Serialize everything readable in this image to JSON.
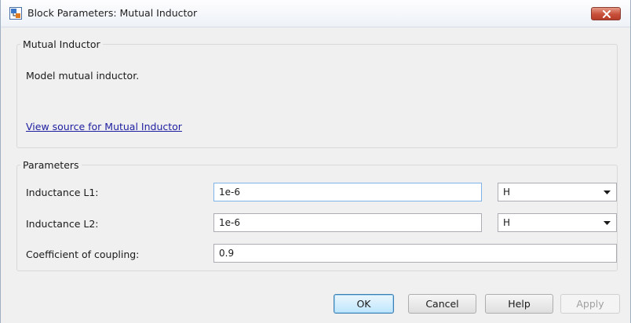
{
  "window": {
    "title": "Block Parameters: Mutual Inductor"
  },
  "description_group": {
    "title": "Mutual Inductor",
    "description": "Model mutual inductor.",
    "source_link": "View source for Mutual Inductor"
  },
  "parameters_group": {
    "title": "Parameters",
    "rows": [
      {
        "label": "Inductance L1:",
        "value": "1e-6",
        "unit": "H"
      },
      {
        "label": "Inductance L2:",
        "value": "1e-6",
        "unit": "H"
      },
      {
        "label": "Coefficient of coupling:",
        "value": "0.9"
      }
    ]
  },
  "buttons": {
    "ok": "OK",
    "cancel": "Cancel",
    "help": "Help",
    "apply": "Apply"
  },
  "colors": {
    "link": "#1e1ea0",
    "close_button": "#c8503a",
    "focus_border": "#7eb4ea"
  }
}
